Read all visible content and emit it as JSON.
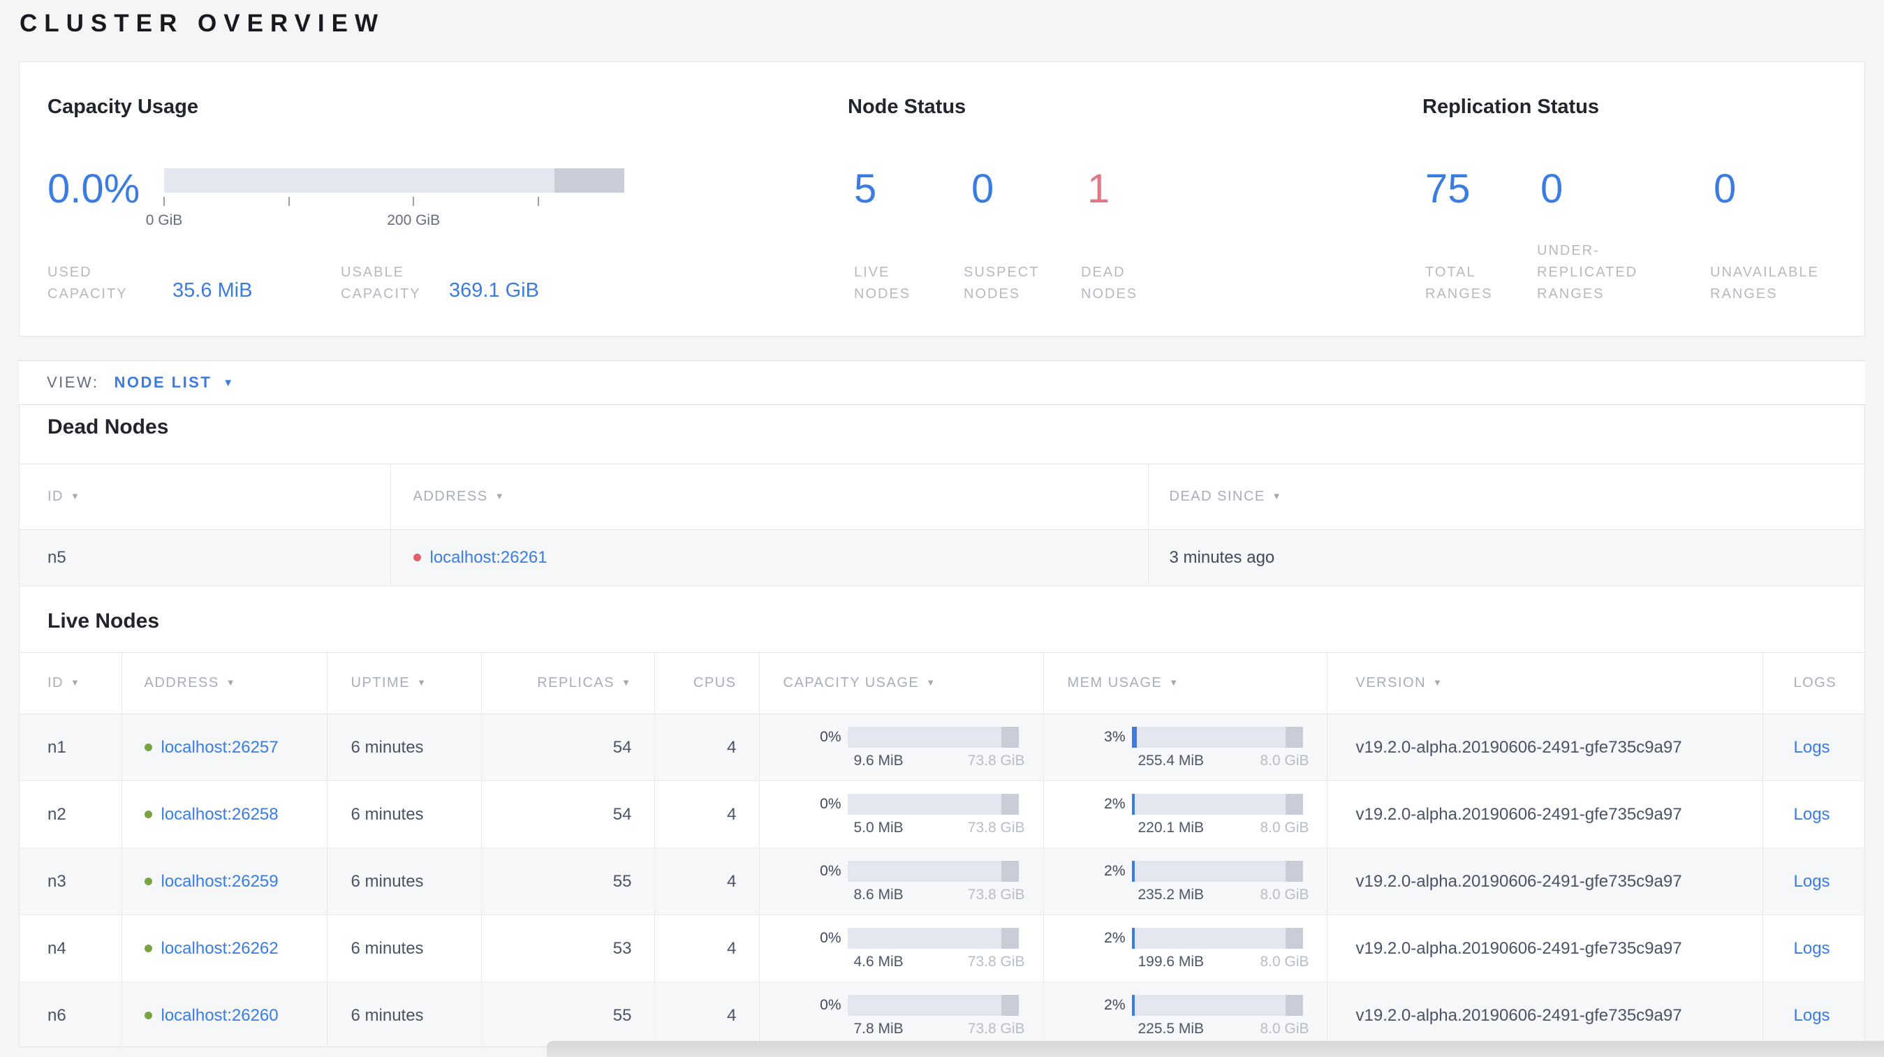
{
  "page": {
    "title": "CLUSTER OVERVIEW"
  },
  "icons": {
    "sort_desc": "▼",
    "dropdown_caret": "▼"
  },
  "colors": {
    "accent_blue": "#3b7ce2",
    "danger_red": "#e17886",
    "live_green": "#77a43c",
    "dead_red": "#e0606b"
  },
  "overview": {
    "capacity": {
      "title": "Capacity Usage",
      "percent_label": "0.0%",
      "bar": {
        "fill_pct": 0,
        "reserved_pct": 15.2,
        "ticks": [
          {
            "label": "0 GiB",
            "pos_pct": 0
          },
          {
            "label": "",
            "pos_pct": 27.1
          },
          {
            "label": "200 GiB",
            "pos_pct": 54.2
          },
          {
            "label": "",
            "pos_pct": 81.3
          }
        ]
      },
      "used": {
        "label": "USED\nCAPACITY",
        "value": "35.6 MiB"
      },
      "usable": {
        "label": "USABLE\nCAPACITY",
        "value": "369.1 GiB"
      }
    },
    "node_status": {
      "title": "Node Status",
      "stats": [
        {
          "value": "5",
          "label": "LIVE\nNODES",
          "tone": "blue"
        },
        {
          "value": "0",
          "label": "SUSPECT\nNODES",
          "tone": "blue"
        },
        {
          "value": "1",
          "label": "DEAD\nNODES",
          "tone": "red"
        }
      ]
    },
    "replication_status": {
      "title": "Replication Status",
      "stats": [
        {
          "value": "75",
          "label": "TOTAL\nRANGES",
          "tone": "blue"
        },
        {
          "value": "0",
          "label": "UNDER-\nREPLICATED\nRANGES",
          "tone": "blue"
        },
        {
          "value": "0",
          "label": "UNAVAILABLE\nRANGES",
          "tone": "blue"
        }
      ]
    }
  },
  "view_bar": {
    "label": "VIEW:",
    "selected": "NODE LIST"
  },
  "dead_nodes": {
    "heading": "Dead Nodes",
    "columns": [
      {
        "label": "ID"
      },
      {
        "label": "ADDRESS"
      },
      {
        "label": "DEAD SINCE"
      }
    ],
    "rows": [
      {
        "id": "n5",
        "address": "localhost:26261",
        "dead_since": "3 minutes ago"
      }
    ]
  },
  "live_nodes": {
    "heading": "Live Nodes",
    "logs_label": "Logs",
    "bar_reserved_pct": 10,
    "columns": [
      {
        "label": "ID"
      },
      {
        "label": "ADDRESS"
      },
      {
        "label": "UPTIME"
      },
      {
        "label": "REPLICAS"
      },
      {
        "label": "CPUS"
      },
      {
        "label": "CAPACITY USAGE"
      },
      {
        "label": "MEM USAGE"
      },
      {
        "label": "VERSION"
      },
      {
        "label": "LOGS"
      }
    ],
    "rows": [
      {
        "id": "n1",
        "address": "localhost:26257",
        "uptime": "6 minutes",
        "replicas": "54",
        "cpus": "4",
        "capacity": {
          "percent": "0%",
          "fill_pct": 0,
          "used": "9.6 MiB",
          "total": "73.8 GiB"
        },
        "memory": {
          "percent": "3%",
          "fill_pct": 3,
          "used": "255.4 MiB",
          "total": "8.0 GiB"
        },
        "version": "v19.2.0-alpha.20190606-2491-gfe735c9a97"
      },
      {
        "id": "n2",
        "address": "localhost:26258",
        "uptime": "6 minutes",
        "replicas": "54",
        "cpus": "4",
        "capacity": {
          "percent": "0%",
          "fill_pct": 0,
          "used": "5.0 MiB",
          "total": "73.8 GiB"
        },
        "memory": {
          "percent": "2%",
          "fill_pct": 2,
          "used": "220.1 MiB",
          "total": "8.0 GiB"
        },
        "version": "v19.2.0-alpha.20190606-2491-gfe735c9a97"
      },
      {
        "id": "n3",
        "address": "localhost:26259",
        "uptime": "6 minutes",
        "replicas": "55",
        "cpus": "4",
        "capacity": {
          "percent": "0%",
          "fill_pct": 0,
          "used": "8.6 MiB",
          "total": "73.8 GiB"
        },
        "memory": {
          "percent": "2%",
          "fill_pct": 2,
          "used": "235.2 MiB",
          "total": "8.0 GiB"
        },
        "version": "v19.2.0-alpha.20190606-2491-gfe735c9a97"
      },
      {
        "id": "n4",
        "address": "localhost:26262",
        "uptime": "6 minutes",
        "replicas": "53",
        "cpus": "4",
        "capacity": {
          "percent": "0%",
          "fill_pct": 0,
          "used": "4.6 MiB",
          "total": "73.8 GiB"
        },
        "memory": {
          "percent": "2%",
          "fill_pct": 2,
          "used": "199.6 MiB",
          "total": "8.0 GiB"
        },
        "version": "v19.2.0-alpha.20190606-2491-gfe735c9a97"
      },
      {
        "id": "n6",
        "address": "localhost:26260",
        "uptime": "6 minutes",
        "replicas": "55",
        "cpus": "4",
        "capacity": {
          "percent": "0%",
          "fill_pct": 0,
          "used": "7.8 MiB",
          "total": "73.8 GiB"
        },
        "memory": {
          "percent": "2%",
          "fill_pct": 2,
          "used": "225.5 MiB",
          "total": "8.0 GiB"
        },
        "version": "v19.2.0-alpha.20190606-2491-gfe735c9a97"
      }
    ]
  }
}
